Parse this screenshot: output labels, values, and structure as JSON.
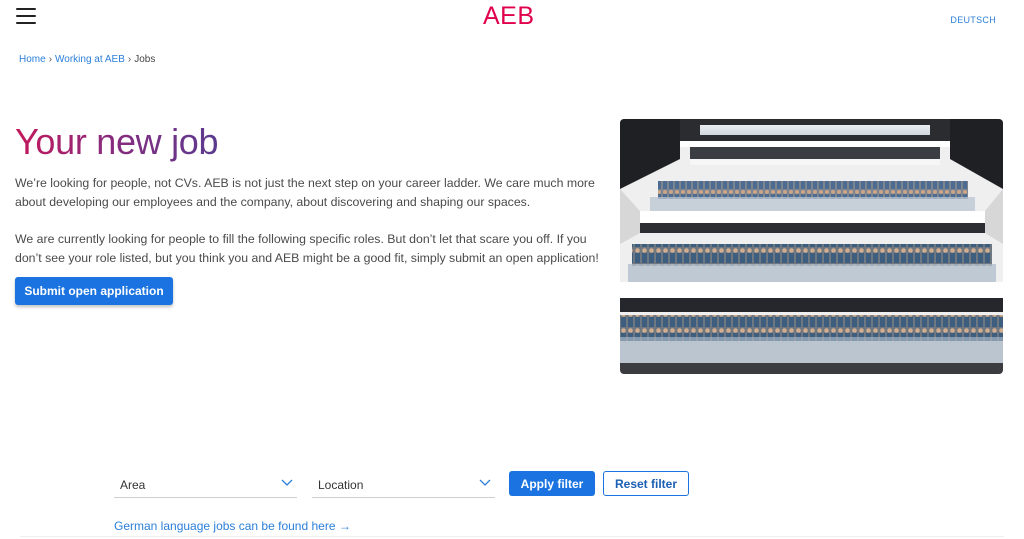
{
  "header": {
    "logo": "AEB",
    "language_link": "DEUTSCH",
    "menu_icon": "hamburger-menu-icon"
  },
  "breadcrumb": {
    "items": [
      "Home",
      "Working at AEB",
      "Jobs"
    ],
    "separator": "›"
  },
  "hero": {
    "title": "Your new job",
    "paragraphs": [
      "We’re looking for people, not CVs. AEB is not just the next step on your career ladder. We care much more about developing our employees and the company, about discovering and shaping our spaces.",
      "We are currently looking for people to fill the following specific roles. But don’t let that scare you off. If you don’t see your role listed, but you think you and AEB might be a good fit, simply submit an open application!"
    ],
    "submit_label": "Submit open application",
    "photo": "atrium-staff-group-photo"
  },
  "filters": {
    "area_label": "Area",
    "location_label": "Location",
    "apply_label": "Apply filter",
    "reset_label": "Reset filter"
  },
  "footer_link": "German language jobs can be found here →",
  "colors": {
    "brand": "#e0004d",
    "link": "#2b7fd9",
    "primary_button": "#1a73e0"
  }
}
